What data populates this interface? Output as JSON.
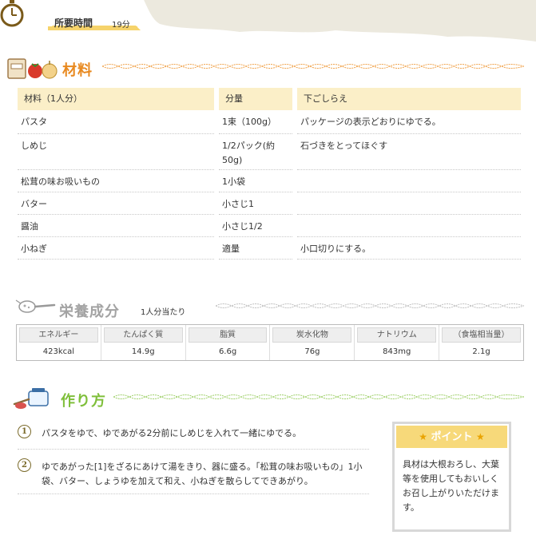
{
  "time": {
    "label": "所要時間",
    "value": "19分"
  },
  "ingredients": {
    "title": "材料",
    "headers": {
      "name": "材料（1人分）",
      "amount": "分量",
      "prep": "下ごしらえ"
    },
    "rows": [
      {
        "name": "パスタ",
        "amount": "1束（100g）",
        "prep": "パッケージの表示どおりにゆでる。"
      },
      {
        "name": "しめじ",
        "amount": "1/2パック(約50g)",
        "prep": "石づきをとってほぐす"
      },
      {
        "name": "松茸の味お吸いもの",
        "amount": "1小袋",
        "prep": ""
      },
      {
        "name": "バター",
        "amount": "小さじ1",
        "prep": ""
      },
      {
        "name": "醤油",
        "amount": "小さじ1/2",
        "prep": ""
      },
      {
        "name": "小ねぎ",
        "amount": "適量",
        "prep": "小口切りにする。"
      }
    ]
  },
  "nutrition": {
    "title": "栄養成分",
    "note": "1人分当たり",
    "items": [
      {
        "label": "エネルギー",
        "value": "423kcal"
      },
      {
        "label": "たんぱく質",
        "value": "14.9g"
      },
      {
        "label": "脂質",
        "value": "6.6g"
      },
      {
        "label": "炭水化物",
        "value": "76g"
      },
      {
        "label": "ナトリウム",
        "value": "843mg"
      },
      {
        "label": "（食塩相当量）",
        "value": "2.1g"
      }
    ]
  },
  "steps": {
    "title": "作り方",
    "items": [
      {
        "num": "1",
        "text": "パスタをゆで、ゆであがる2分前にしめじを入れて一緒にゆでる。"
      },
      {
        "num": "2",
        "text": "ゆであがった[1]をざるにあけて湯をきり、器に盛る。「松茸の味お吸いもの」1小袋、バター、しょうゆを加えて和え、小ねぎを散らしてできあがり。"
      }
    ]
  },
  "point": {
    "title": "ポイント",
    "text": "具材は大根おろし、大葉等を使用してもおいしくお召し上がりいただけます。"
  },
  "colors": {
    "orange": "#e8891f",
    "gray_heading": "#9a9a9a",
    "green": "#7fbf3b",
    "table_head": "#fbefc8",
    "point_head": "#f7d97a"
  }
}
